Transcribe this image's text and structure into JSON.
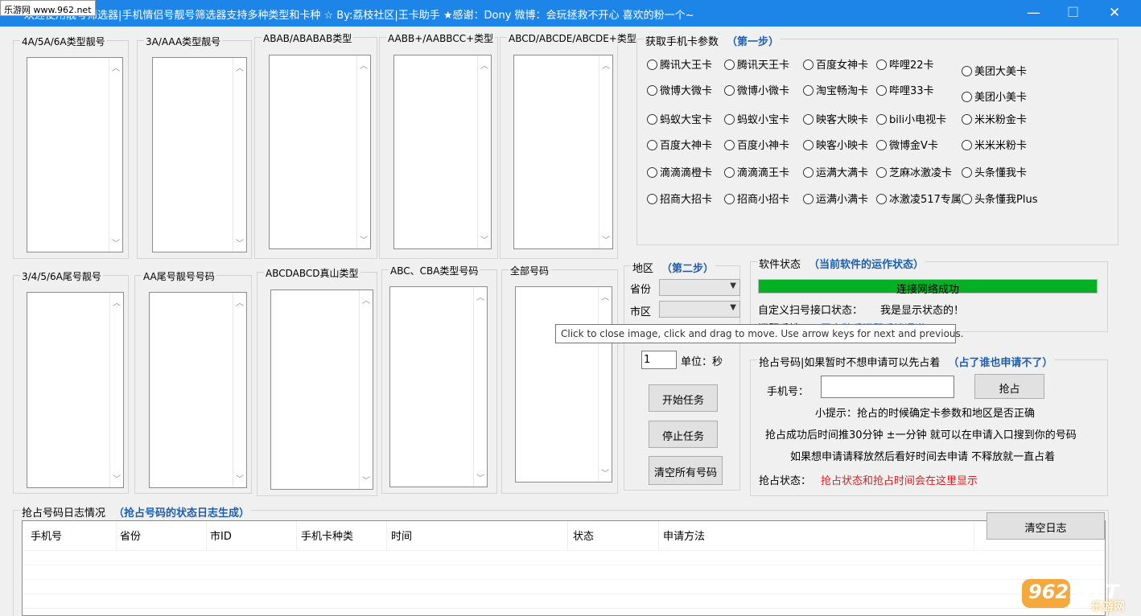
{
  "title_bar": {
    "title": "欢迎使用靓号筛选器|手机情侣号靓号筛选器支持多种类型和卡种  ☆ By:荔枝社区|王卡助手  ★感谢：Dony        微博：会玩拯救不开心   喜欢的粉一个~",
    "minimize": "—",
    "maximize": "☐",
    "close": "✕"
  },
  "watermark_top": "乐游网 www.962.net",
  "number_groups": [
    {
      "label": "4A/5A/6A类型靓号"
    },
    {
      "label": "3A/AAA类型靓号"
    },
    {
      "label": "ABAB/ABABAB类型"
    },
    {
      "label": "AABB+/AABBCC+类型"
    },
    {
      "label": "ABCD/ABCDE/ABCDE+类型"
    },
    {
      "label": "3/4/5/6A尾号靓号"
    },
    {
      "label": "AA尾号靓号号码"
    },
    {
      "label": "ABCDABCD真山类型"
    },
    {
      "label": "ABC、CBA类型号码"
    },
    {
      "label": "全部号码"
    }
  ],
  "card_params": {
    "label": "获取手机卡参数",
    "step": "（第一步）",
    "options": [
      "腾讯大王卡",
      "腾讯天王卡",
      "百度女神卡",
      "哔哩22卡",
      "美团大美卡",
      "微博大微卡",
      "微博小微卡",
      "淘宝畅淘卡",
      "哔哩33卡",
      "美团小美卡",
      "蚂蚁大宝卡",
      "蚂蚁小宝卡",
      "映客大映卡",
      "bili小电视卡",
      "米米粉金卡",
      "百度大神卡",
      "百度小神卡",
      "映客小映卡",
      "微博金V卡",
      "米米米粉卡",
      "滴滴滴橙卡",
      "滴滴滴王卡",
      "运满大满卡",
      "芝麻冰激凌卡",
      "头条懂我卡",
      "招商大招卡",
      "招商小招卡",
      "运满小满卡",
      "冰激凌517专属",
      "头条懂我Plus"
    ]
  },
  "region": {
    "label": "地区",
    "step": "（第二步）",
    "province_label": "省份",
    "city_label": "市区",
    "interval_value": "1",
    "unit_label": "单位：秒",
    "start_button": "开始任务",
    "stop_button": "停止任务",
    "clear_button": "清空所有号码"
  },
  "software_status": {
    "label": "软件状态",
    "note": "（当前软件的运作状态）",
    "progress_percent": 100,
    "progress_text": "连接网络成功",
    "scan_label": "自定义扫号接口状态：",
    "scan_value": "我是显示状态的！",
    "feedback_label": "问题反馈：",
    "feedback_link": "王卡助手问题反馈通道"
  },
  "tooltip": "Click to close image, click and drag to move. Use arrow keys for next and previous.",
  "grab": {
    "label": "抢占号码|如果暂时不想申请可以先占着",
    "note": "（占了谁也申请不了）",
    "phone_label": "手机号：",
    "phone_value": "",
    "grab_button": "抢占",
    "tip1": "小提示：抢占的时候确定卡参数和地区是否正确",
    "tip2": "抢占成功后时间推30分钟 ±一分钟 就可以在申请入口搜到你的号码",
    "tip3": "如果想申请请释放然后看好时间去申请 不释放就一直占着",
    "status_label": "抢占状态：",
    "status_value": "抢占状态和抢占时间会在这里显示"
  },
  "log": {
    "label": "抢占号码日志情况",
    "note": "（抢占号码的状态日志生成）",
    "columns": [
      "手机号",
      "省份",
      "市ID",
      "手机卡种类",
      "时间",
      "状态",
      "申请方法"
    ],
    "clear_button": "清空日志"
  },
  "watermark_br": {
    "logo": "962.NET",
    "sub": "乐游网"
  },
  "colors": {
    "title_bar": "#1d85e8",
    "accent_blue": "#1c5fb0",
    "progress": "#06b025",
    "status_red": "#e02020"
  }
}
